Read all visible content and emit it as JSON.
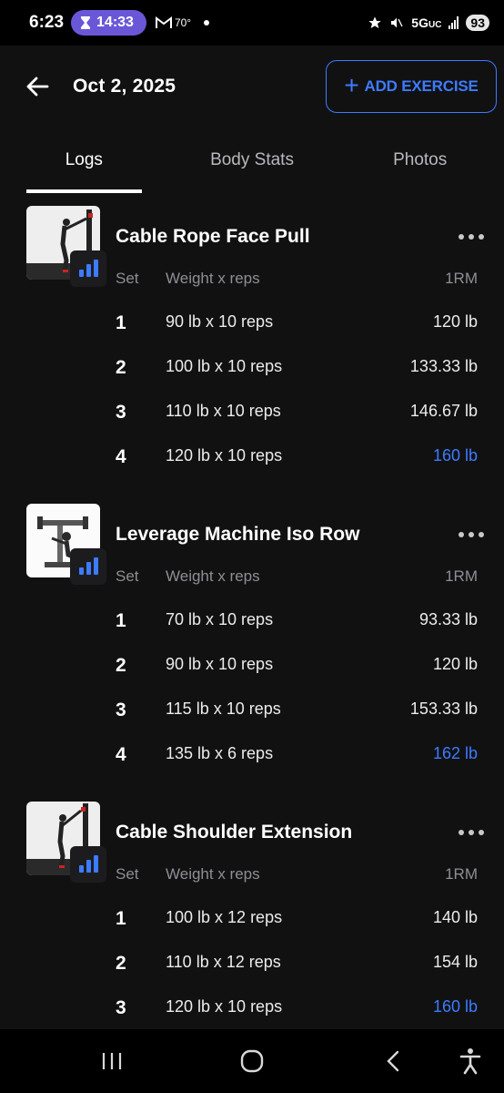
{
  "status_bar": {
    "time": "6:23",
    "timer": "14:33",
    "temp": "70°",
    "network": "5G",
    "network_sub": "UC",
    "battery": "93"
  },
  "header": {
    "date": "Oct 2, 2025",
    "add_label": "ADD EXERCISE"
  },
  "tabs": [
    {
      "label": "Logs",
      "active": true
    },
    {
      "label": "Body Stats",
      "active": false
    },
    {
      "label": "Photos",
      "active": false
    }
  ],
  "columns": {
    "set": "Set",
    "weight_reps": "Weight x reps",
    "one_rm": "1RM"
  },
  "exercises": [
    {
      "name": "Cable Rope Face Pull",
      "sets": [
        {
          "set": "1",
          "weight_reps": "90 lb x 10 reps",
          "one_rm": "120 lb",
          "best": false
        },
        {
          "set": "2",
          "weight_reps": "100 lb x 10 reps",
          "one_rm": "133.33 lb",
          "best": false
        },
        {
          "set": "3",
          "weight_reps": "110 lb x 10 reps",
          "one_rm": "146.67 lb",
          "best": false
        },
        {
          "set": "4",
          "weight_reps": "120 lb x 10 reps",
          "one_rm": "160 lb",
          "best": true
        }
      ]
    },
    {
      "name": "Leverage Machine Iso Row",
      "sets": [
        {
          "set": "1",
          "weight_reps": "70 lb x 10 reps",
          "one_rm": "93.33 lb",
          "best": false
        },
        {
          "set": "2",
          "weight_reps": "90 lb x 10 reps",
          "one_rm": "120 lb",
          "best": false
        },
        {
          "set": "3",
          "weight_reps": "115 lb x 10 reps",
          "one_rm": "153.33 lb",
          "best": false
        },
        {
          "set": "4",
          "weight_reps": "135 lb x 6 reps",
          "one_rm": "162 lb",
          "best": true
        }
      ]
    },
    {
      "name": "Cable Shoulder Extension",
      "sets": [
        {
          "set": "1",
          "weight_reps": "100 lb x 12 reps",
          "one_rm": "140 lb",
          "best": false
        },
        {
          "set": "2",
          "weight_reps": "110 lb x 12 reps",
          "one_rm": "154 lb",
          "best": false
        },
        {
          "set": "3",
          "weight_reps": "120 lb x 10 reps",
          "one_rm": "160 lb",
          "best": true
        }
      ]
    }
  ],
  "colors": {
    "accent": "#3d7bff",
    "background": "#111112",
    "timer_pill": "#6a57d8"
  },
  "icons": [
    "back-arrow-icon",
    "plus-icon",
    "chart-icon",
    "more-icon",
    "recents-icon",
    "home-icon",
    "back-icon",
    "accessibility-icon"
  ]
}
